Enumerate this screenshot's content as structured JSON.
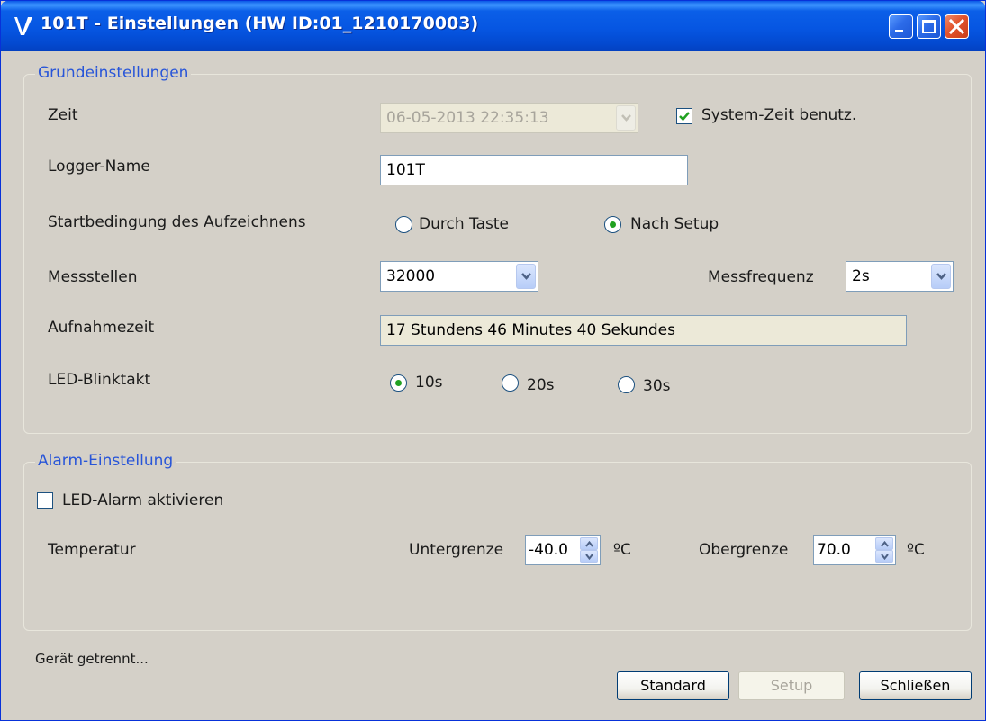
{
  "window": {
    "title": "101T - Einstellungen (HW ID:01_1210170003)"
  },
  "basic": {
    "title": "Grundeinstellungen",
    "zeit_label": "Zeit",
    "zeit_value": "06-05-2013 22:35:13",
    "system_time_label": "System-Zeit benutz.",
    "system_time_checked": true,
    "logger_name_label": "Logger-Name",
    "logger_name_value": "101T",
    "start_condition_label": "Startbedingung des Aufzeichnens",
    "start_options": [
      {
        "label": "Durch Taste",
        "selected": false
      },
      {
        "label": "Nach Setup",
        "selected": true
      }
    ],
    "messstellen_label": "Messstellen",
    "messstellen_value": "32000",
    "messfrequenz_label": "Messfrequenz",
    "messfrequenz_value": "2s",
    "aufnahmezeit_label": "Aufnahmezeit",
    "aufnahmezeit_value": "17 Stundens 46 Minutes 40 Sekundes",
    "led_label": "LED-Blinktakt",
    "led_options": [
      {
        "label": "10s",
        "selected": true
      },
      {
        "label": "20s",
        "selected": false
      },
      {
        "label": "30s",
        "selected": false
      }
    ]
  },
  "alarm": {
    "title": "Alarm-Einstellung",
    "led_alarm_label": "LED-Alarm aktivieren",
    "led_alarm_checked": false,
    "temperature_label": "Temperatur",
    "lower_label": "Untergrenze",
    "lower_value": "-40.0",
    "upper_label": "Obergrenze",
    "upper_value": "70.0",
    "unit": "ºC"
  },
  "status": {
    "text": "Gerät getrennt..."
  },
  "buttons": {
    "standard": "Standard",
    "setup": "Setup",
    "close": "Schließen"
  },
  "colors": {
    "titlebar": "#0656e2",
    "group_title": "#2855d8",
    "radio_dot": "#21a121",
    "background": "#d4d0c8"
  },
  "icons": {
    "app": "v-logo-icon",
    "minimize": "minimize-icon",
    "maximize": "maximize-icon",
    "close": "close-icon"
  }
}
